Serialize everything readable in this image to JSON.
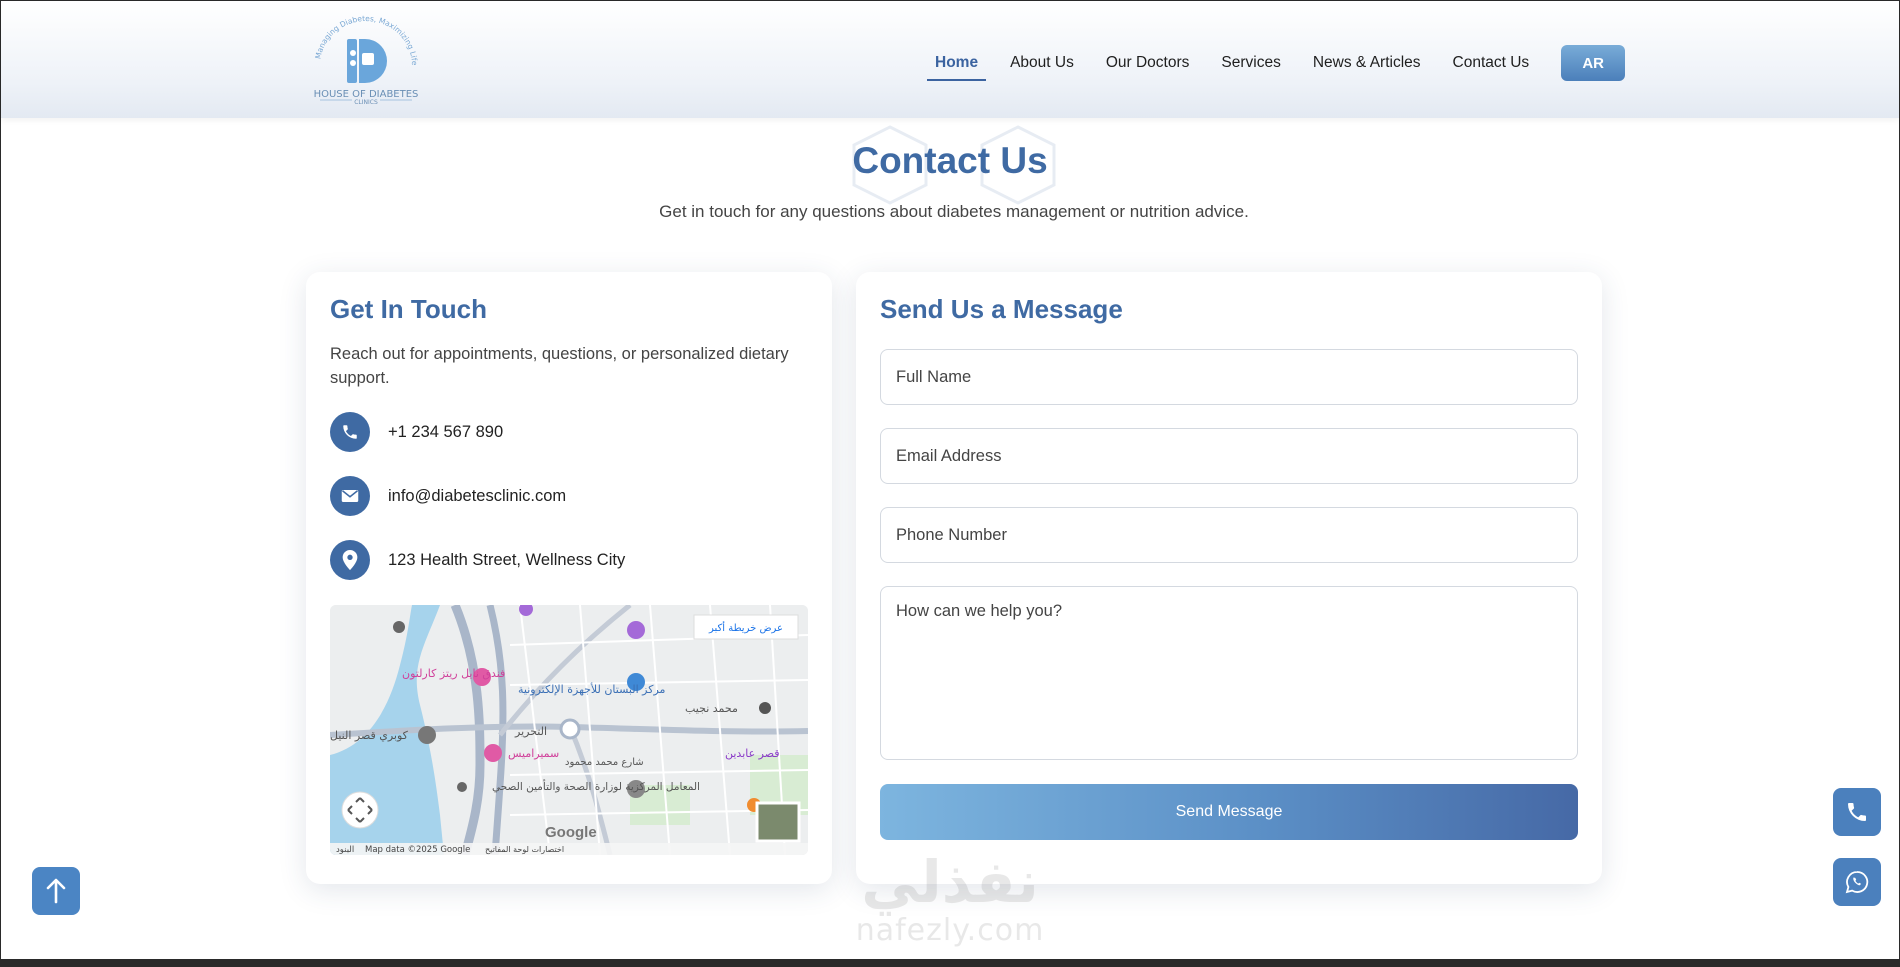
{
  "logo": {
    "tagline": "Managing Diabetes, Maximizing Life",
    "name": "HOUSE OF DIABETES",
    "sub": "CLINICS"
  },
  "nav": {
    "items": [
      {
        "label": "Home",
        "active": true
      },
      {
        "label": "About Us"
      },
      {
        "label": "Our Doctors"
      },
      {
        "label": "Services"
      },
      {
        "label": "News & Articles"
      },
      {
        "label": "Contact Us"
      }
    ],
    "lang_label": "AR"
  },
  "page": {
    "title": "Contact Us",
    "subtitle": "Get in touch for any questions about diabetes management or nutrition advice."
  },
  "contact": {
    "heading": "Get In Touch",
    "intro": "Reach out for appointments, questions, or personalized dietary support.",
    "phone": "+1 234 567 890",
    "email": "info@diabetesclinic.com",
    "address": "123 Health Street, Wellness City"
  },
  "map": {
    "view_larger": "عرض خريطة أكبر",
    "brand": "Google",
    "attribution": "Map data ©2025 Google",
    "shortcuts": "اختصارات لوحة المفاتيح",
    "terms": "البنود",
    "labels": [
      "فندق نايل ريتز كارلتون",
      "مركز البستان للأجهزة الإلكترونية",
      "كوبري قصر النيل",
      "سميراميس",
      "التحرير",
      "محمد نجيب",
      "المعامل المركزية لوزارة الصحة والتأمين الصحي",
      "قصر عابدين",
      "شارع محمد محمود"
    ]
  },
  "form": {
    "heading": "Send Us a Message",
    "name_placeholder": "Full Name",
    "email_placeholder": "Email Address",
    "phone_placeholder": "Phone Number",
    "message_placeholder": "How can we help you?",
    "submit_label": "Send Message"
  },
  "watermark": {
    "arabic": "نفذلي",
    "latin": "nafezly.com"
  },
  "colors": {
    "brand_blue": "#3f6aa3",
    "button_light": "#7db5df",
    "button_dark": "#4669a6"
  },
  "icons": {
    "phone": "phone-icon",
    "email": "envelope-icon",
    "address": "map-pin-icon",
    "scroll_top": "arrow-up-icon",
    "whatsapp": "whatsapp-icon"
  }
}
